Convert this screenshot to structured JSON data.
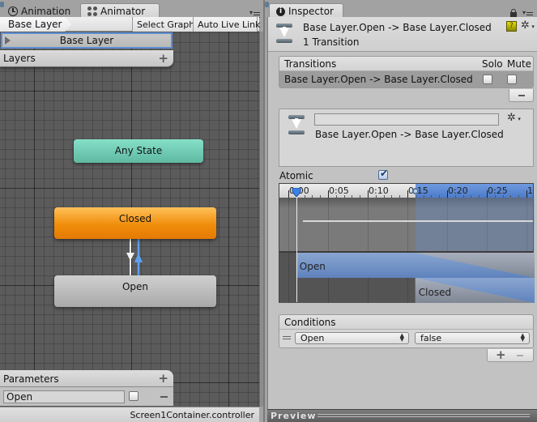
{
  "animator_window": {
    "tabs": [
      {
        "label": "Animation",
        "icon": "clock-icon",
        "active": false
      },
      {
        "label": "Animator",
        "icon": "animator-icon",
        "active": true
      }
    ],
    "toolbar": {
      "breadcrumb": "Base Layer",
      "select_graph_label": "Select Graph",
      "auto_live_link_label": "Auto Live Link"
    },
    "layers": {
      "header": "Layers",
      "items": [
        {
          "label": "Base Layer",
          "selected": true
        }
      ]
    },
    "states": [
      {
        "id": "any",
        "label": "Any State",
        "color": "#6fccb5"
      },
      {
        "id": "closed",
        "label": "Closed",
        "color": "#f08d0b",
        "default": true
      },
      {
        "id": "open",
        "label": "Open",
        "color": "#bcbcbc"
      }
    ],
    "transitions": [
      {
        "from": "Closed",
        "to": "Open",
        "color": "#ffffff"
      },
      {
        "from": "Open",
        "to": "Closed",
        "color": "#5ea0f0",
        "selected": true
      }
    ],
    "parameters": {
      "header": "Parameters",
      "items": [
        {
          "name": "Open",
          "type": "bool",
          "value": false
        }
      ]
    },
    "status": "Screen1Container.controller"
  },
  "inspector": {
    "tab_label": "Inspector",
    "title": "Base Layer.Open -> Base Layer.Closed",
    "subtitle": "1 Transition",
    "transitions_list": {
      "header": "Transitions",
      "col_solo": "Solo",
      "col_mute": "Mute",
      "rows": [
        {
          "label": "Base Layer.Open -> Base Layer.Closed",
          "solo": false,
          "mute": false
        }
      ]
    },
    "transition_detail": {
      "name_value": "",
      "label": "Base Layer.Open -> Base Layer.Closed"
    },
    "atomic": {
      "label": "Atomic",
      "checked": true
    },
    "timeline": {
      "ticks": [
        "0:00",
        "0:05",
        "0:10",
        "0:15",
        "0:20",
        "0:25",
        "1"
      ],
      "source_state": "Open",
      "dest_state": "Closed",
      "playhead_frame": 1,
      "transition_start_frame": 16,
      "frame_max": 30
    },
    "conditions": {
      "header": "Conditions",
      "rows": [
        {
          "parameter": "Open",
          "value": "false"
        }
      ]
    },
    "preview_label": "Preview"
  }
}
